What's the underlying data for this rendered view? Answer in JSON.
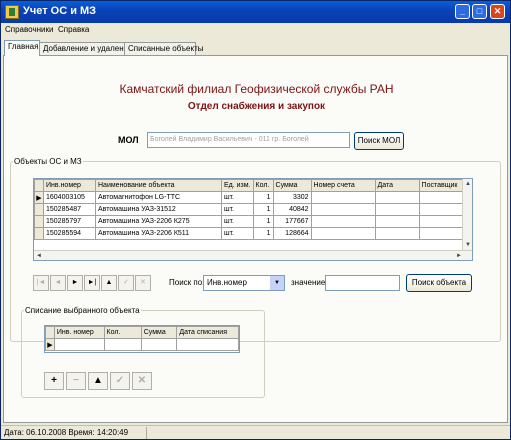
{
  "window": {
    "title": "Учет ОС и МЗ",
    "min": "_",
    "max": "□",
    "close": "✕"
  },
  "menu": [
    "Справочники",
    "Справка"
  ],
  "tabs": [
    "Главная",
    "Добавление и удаление",
    "Списанные объекты"
  ],
  "header": {
    "title": "Камчатский филиал Геофизической службы РАН",
    "subtitle": "Отдел снабжения и закупок"
  },
  "mol": {
    "label": "МОЛ",
    "value": "Боголей Владимир Васильевич - 011 гр. Боголей",
    "button": "Поиск МОЛ"
  },
  "objects": {
    "legend": "Объекты ОС и МЗ",
    "columns": [
      "Инв.номер",
      "Наименование объекта",
      "Ед. изм.",
      "Кол.",
      "Сумма",
      "Номер счета",
      "Дата",
      "Поставщик"
    ],
    "rows": [
      [
        "1604003105",
        "Автомагнитофон LG-TTC",
        "шт.",
        "1",
        "3302",
        "",
        "",
        ""
      ],
      [
        "150285487",
        "Автомашина УАЗ-31512",
        "шт.",
        "1",
        "40842",
        "",
        "",
        ""
      ],
      [
        "150285797",
        "Автомашина УАЗ-2206 К275",
        "шт.",
        "1",
        "177667",
        "",
        "",
        ""
      ],
      [
        "150285594",
        "Автомашина УАЗ-2206 К511",
        "шт.",
        "1",
        "128664",
        "",
        "",
        ""
      ]
    ],
    "current_row": 0
  },
  "navigator": {
    "buttons": [
      "|◄",
      "◄",
      "►",
      "►|",
      "▲",
      "✓",
      "✕"
    ],
    "enabled": [
      false,
      false,
      true,
      true,
      true,
      false,
      false
    ]
  },
  "search": {
    "label": "Поиск по:",
    "field": "Инв.номер",
    "value_label": "значение",
    "value": "",
    "button": "Поиск объекта"
  },
  "writeoff": {
    "legend": "Списание выбранного объекта",
    "columns": [
      "Инв. номер",
      "Кол.",
      "Сумма",
      "Дата списания"
    ],
    "buttons": [
      "+",
      "−",
      "▲",
      "✓",
      "✕"
    ],
    "enabled": [
      true,
      false,
      true,
      false,
      false
    ]
  },
  "status": {
    "text": "Дата: 06.10.2008  Время:  14:20:49"
  }
}
